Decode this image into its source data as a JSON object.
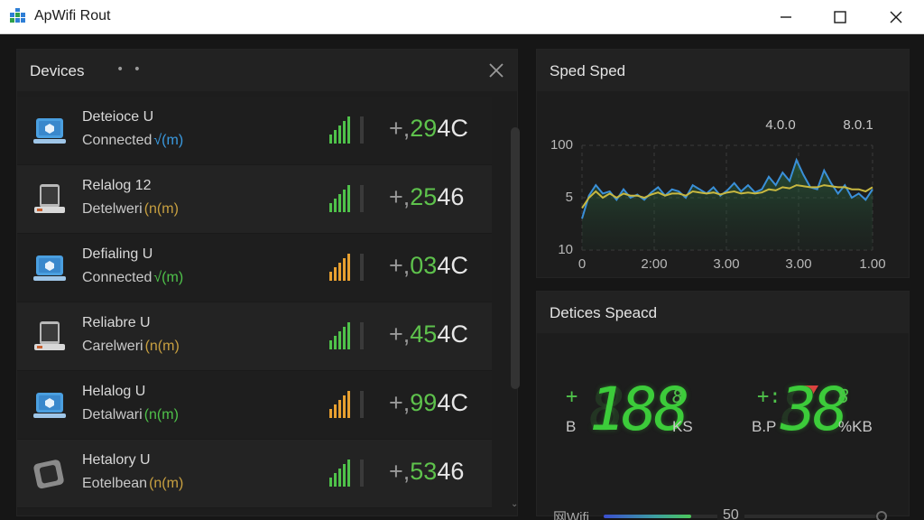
{
  "window": {
    "title": "ApWifi Rout"
  },
  "devices_panel": {
    "title": "Devices",
    "dots": "• •",
    "items": [
      {
        "name": "Deteioce U",
        "status": "Connected",
        "tag": "√(m)",
        "tag_color": "#3a9ae0",
        "icon": "laptop-icon",
        "signal_color": "#4fc24a",
        "value_prefix": "+,",
        "value_green": "29",
        "value_white": "4C"
      },
      {
        "name": "Relalog 12",
        "status": "Detelweri",
        "tag": "(n(m)",
        "tag_color": "#c8a040",
        "icon": "phone-icon",
        "signal_color": "#4fc24a",
        "value_prefix": "+,",
        "value_green": "25",
        "value_white": "46"
      },
      {
        "name": "Defialing U",
        "status": "Connected",
        "tag": "√(m)",
        "tag_color": "#4fc24a",
        "icon": "laptop-icon",
        "signal_color": "#e8a030",
        "value_prefix": "+,",
        "value_green": "03",
        "value_white": "4C"
      },
      {
        "name": "Reliabre U",
        "status": "Carelweri",
        "tag": "(n(m)",
        "tag_color": "#c8a040",
        "icon": "phone-icon",
        "signal_color": "#4fc24a",
        "value_prefix": "+,",
        "value_green": "45",
        "value_white": "4C"
      },
      {
        "name": "Helalog U",
        "status": "Detalwari",
        "tag": "(n(m)",
        "tag_color": "#4fc24a",
        "icon": "laptop-icon",
        "signal_color": "#e8a030",
        "value_prefix": "+,",
        "value_green": "99",
        "value_white": "4C"
      },
      {
        "name": "Hetalory U",
        "status": "Eotelbean",
        "tag": "(n(m)",
        "tag_color": "#c8a040",
        "icon": "tablet-icon",
        "signal_color": "#4fc24a",
        "value_prefix": "+,",
        "value_green": "53",
        "value_white": "46"
      }
    ]
  },
  "speed_panel": {
    "title": "Sped Sped"
  },
  "chart_data": {
    "type": "line",
    "title": "",
    "x_tick_labels": [
      "0",
      "2:00",
      "3.00",
      "3.00",
      "1.00"
    ],
    "y_tick_labels": [
      "100",
      "5",
      "10"
    ],
    "top_labels": [
      "4.0.0",
      "8.0.1"
    ],
    "series": [
      {
        "color": "#3a8fd8",
        "values": [
          30,
          52,
          62,
          54,
          56,
          48,
          58,
          50,
          53,
          48,
          55,
          60,
          52,
          58,
          56,
          50,
          62,
          58,
          54,
          60,
          52,
          57,
          64,
          56,
          62,
          55,
          58,
          70,
          62,
          74,
          66,
          86,
          72,
          60,
          58,
          76,
          64,
          54,
          62,
          50,
          54,
          48,
          58
        ]
      },
      {
        "color": "#c8b840",
        "values": [
          40,
          50,
          56,
          50,
          54,
          50,
          54,
          52,
          52,
          50,
          53,
          55,
          52,
          54,
          54,
          52,
          56,
          55,
          54,
          55,
          53,
          55,
          56,
          54,
          55,
          54,
          55,
          58,
          57,
          60,
          59,
          62,
          61,
          60,
          60,
          62,
          61,
          60,
          60,
          58,
          58,
          56,
          60
        ]
      }
    ]
  },
  "devspeed_panel": {
    "title": "Detices Speacd",
    "left": {
      "prefix": "+",
      "digits": "188",
      "ghost": "888",
      "super": "8",
      "label_left": "B",
      "label_right": "KS"
    },
    "right": {
      "prefix": "+:",
      "digits": "38",
      "ghost": "88",
      "super": "8",
      "label_left": "B.P",
      "label_right": "%KB"
    },
    "wifi_label": "网Wifi",
    "slider_value": "50",
    "slider_fraction": 0.32
  },
  "colors": {
    "accent_green": "#4fc24a",
    "accent_orange": "#e8a030",
    "accent_blue": "#3a9ae0",
    "marker_red": "#e04040"
  }
}
